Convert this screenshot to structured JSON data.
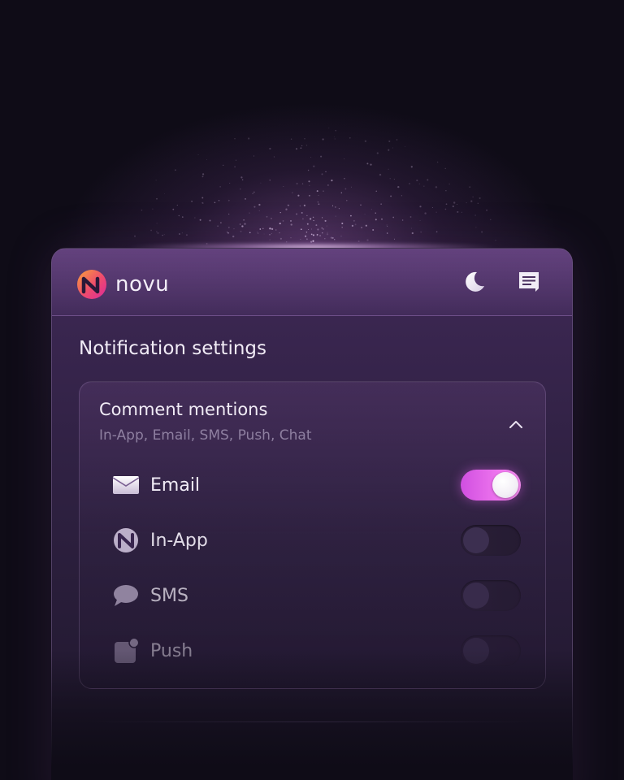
{
  "app": {
    "brand_name": "novu"
  },
  "header": {
    "theme_toggle_icon": "moon-icon",
    "inbox_icon": "message-icon"
  },
  "settings": {
    "title": "Notification settings"
  },
  "workflow": {
    "title": "Comment mentions",
    "subtitle": "In-App, Email, SMS, Push, Chat",
    "expanded": true,
    "collapse_icon": "chevron-up-icon"
  },
  "channels": [
    {
      "label": "Email",
      "icon": "envelope-icon",
      "enabled": true
    },
    {
      "label": "In-App",
      "icon": "novu-logo-icon",
      "enabled": false
    },
    {
      "label": "SMS",
      "icon": "chat-bubble-icon",
      "enabled": false
    },
    {
      "label": "Push",
      "icon": "push-notification-icon",
      "enabled": false
    }
  ],
  "colors": {
    "accent": "#f27af0",
    "background": "#0f0c17",
    "card": "#2f2142",
    "text_primary": "#f1ecf6",
    "text_secondary": "#8e7fa0",
    "logo_pink": "#e8308a",
    "logo_orange": "#f7a23a"
  }
}
